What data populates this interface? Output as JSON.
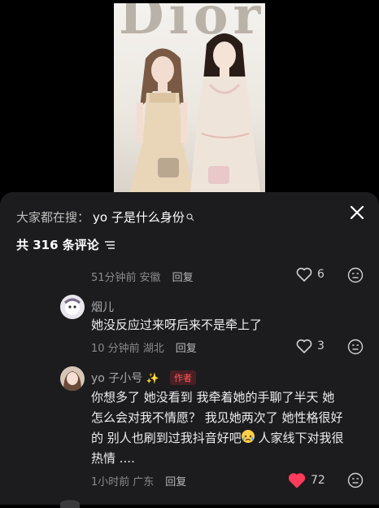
{
  "video": {
    "brand_watermark": "Dior"
  },
  "search": {
    "prefix": "大家都在搜：",
    "term": "yo 子是什么身份",
    "icon": "search-icon"
  },
  "comments_header": {
    "count_label": "共 316 条评论"
  },
  "comments": [
    {
      "id": "prev",
      "time": "51分钟前",
      "location": "安徽",
      "reply_label": "回复",
      "likes": "6"
    },
    {
      "id": "yaner",
      "username": "烟儿",
      "text": "她没反应过来呀后来不是牵上了",
      "time": "10 分钟前",
      "location": "湖北",
      "reply_label": "回复",
      "likes": "3"
    },
    {
      "id": "author",
      "username": "yo 子小号",
      "badge": "作者",
      "text_line1": "你想多了 她没看到 我牵着她的手聊了半天  她",
      "text_line2": "怎么会对我不情愿？ 我见她两次了 她性格很好",
      "text_line3a": "的 别人也刷到过我抖音好吧",
      "text_line3b": " 人家线下对我很",
      "text_line4": "热情 ....",
      "time": "1小时前",
      "location": "广东",
      "reply_label": "回复",
      "likes": "72"
    }
  ],
  "colors": {
    "sheet_bg": "#1c1c1e",
    "liked_red": "#ff3b5c",
    "author_badge": "#ff5a5a"
  }
}
